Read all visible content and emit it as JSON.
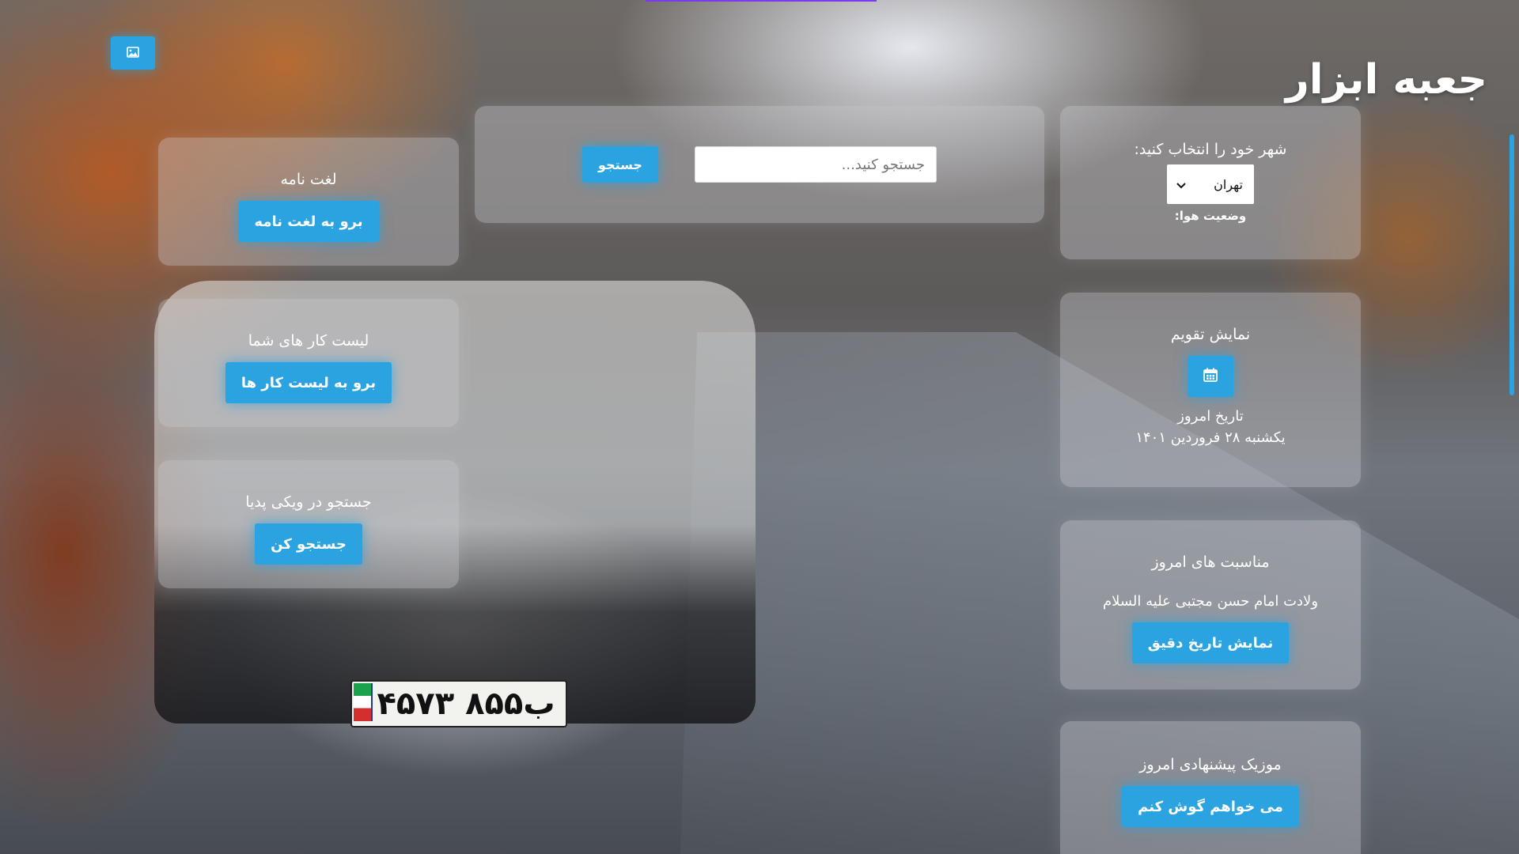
{
  "app": {
    "title": "جعبه ابزار"
  },
  "background_button": {
    "icon": "image-icon"
  },
  "search": {
    "placeholder": "جستجو کنید...",
    "value": "",
    "button_label": "جستجو"
  },
  "weather": {
    "prompt": "شهر خود را انتخاب کنید:",
    "selected_city": "تهران",
    "status_label": "وضعیت هوا:"
  },
  "dictionary": {
    "title": "لغت نامه",
    "button_label": "برو به لغت نامه"
  },
  "todo": {
    "title": "لیست کار های شما",
    "button_label": "برو به لیست کار ها"
  },
  "wikipedia": {
    "title": "جستجو در ویکی پدیا",
    "button_label": "جستجو کن"
  },
  "calendar": {
    "title": "نمایش تقویم",
    "button_icon": "calendar-icon",
    "today_label": "تاریخ امروز",
    "today_date": "یکشنبه ۲۸ فروردین ۱۴۰۱"
  },
  "occasions": {
    "title": "مناسبت های امروز",
    "text": "ولادت امام حسن مجتبی علیه السلام",
    "button_label": "نمایش تاریخ دقیق"
  },
  "music": {
    "title": "موزیک پیشنهادی امروز",
    "button_label": "می خواهم گوش کنم"
  },
  "background_photo": {
    "plate_text": "۴۵ب۸۵۵ ۷۳"
  },
  "colors": {
    "accent": "#2aa3e0",
    "card_background": "rgba(205,205,210,0.38)",
    "text": "#ffffff"
  }
}
